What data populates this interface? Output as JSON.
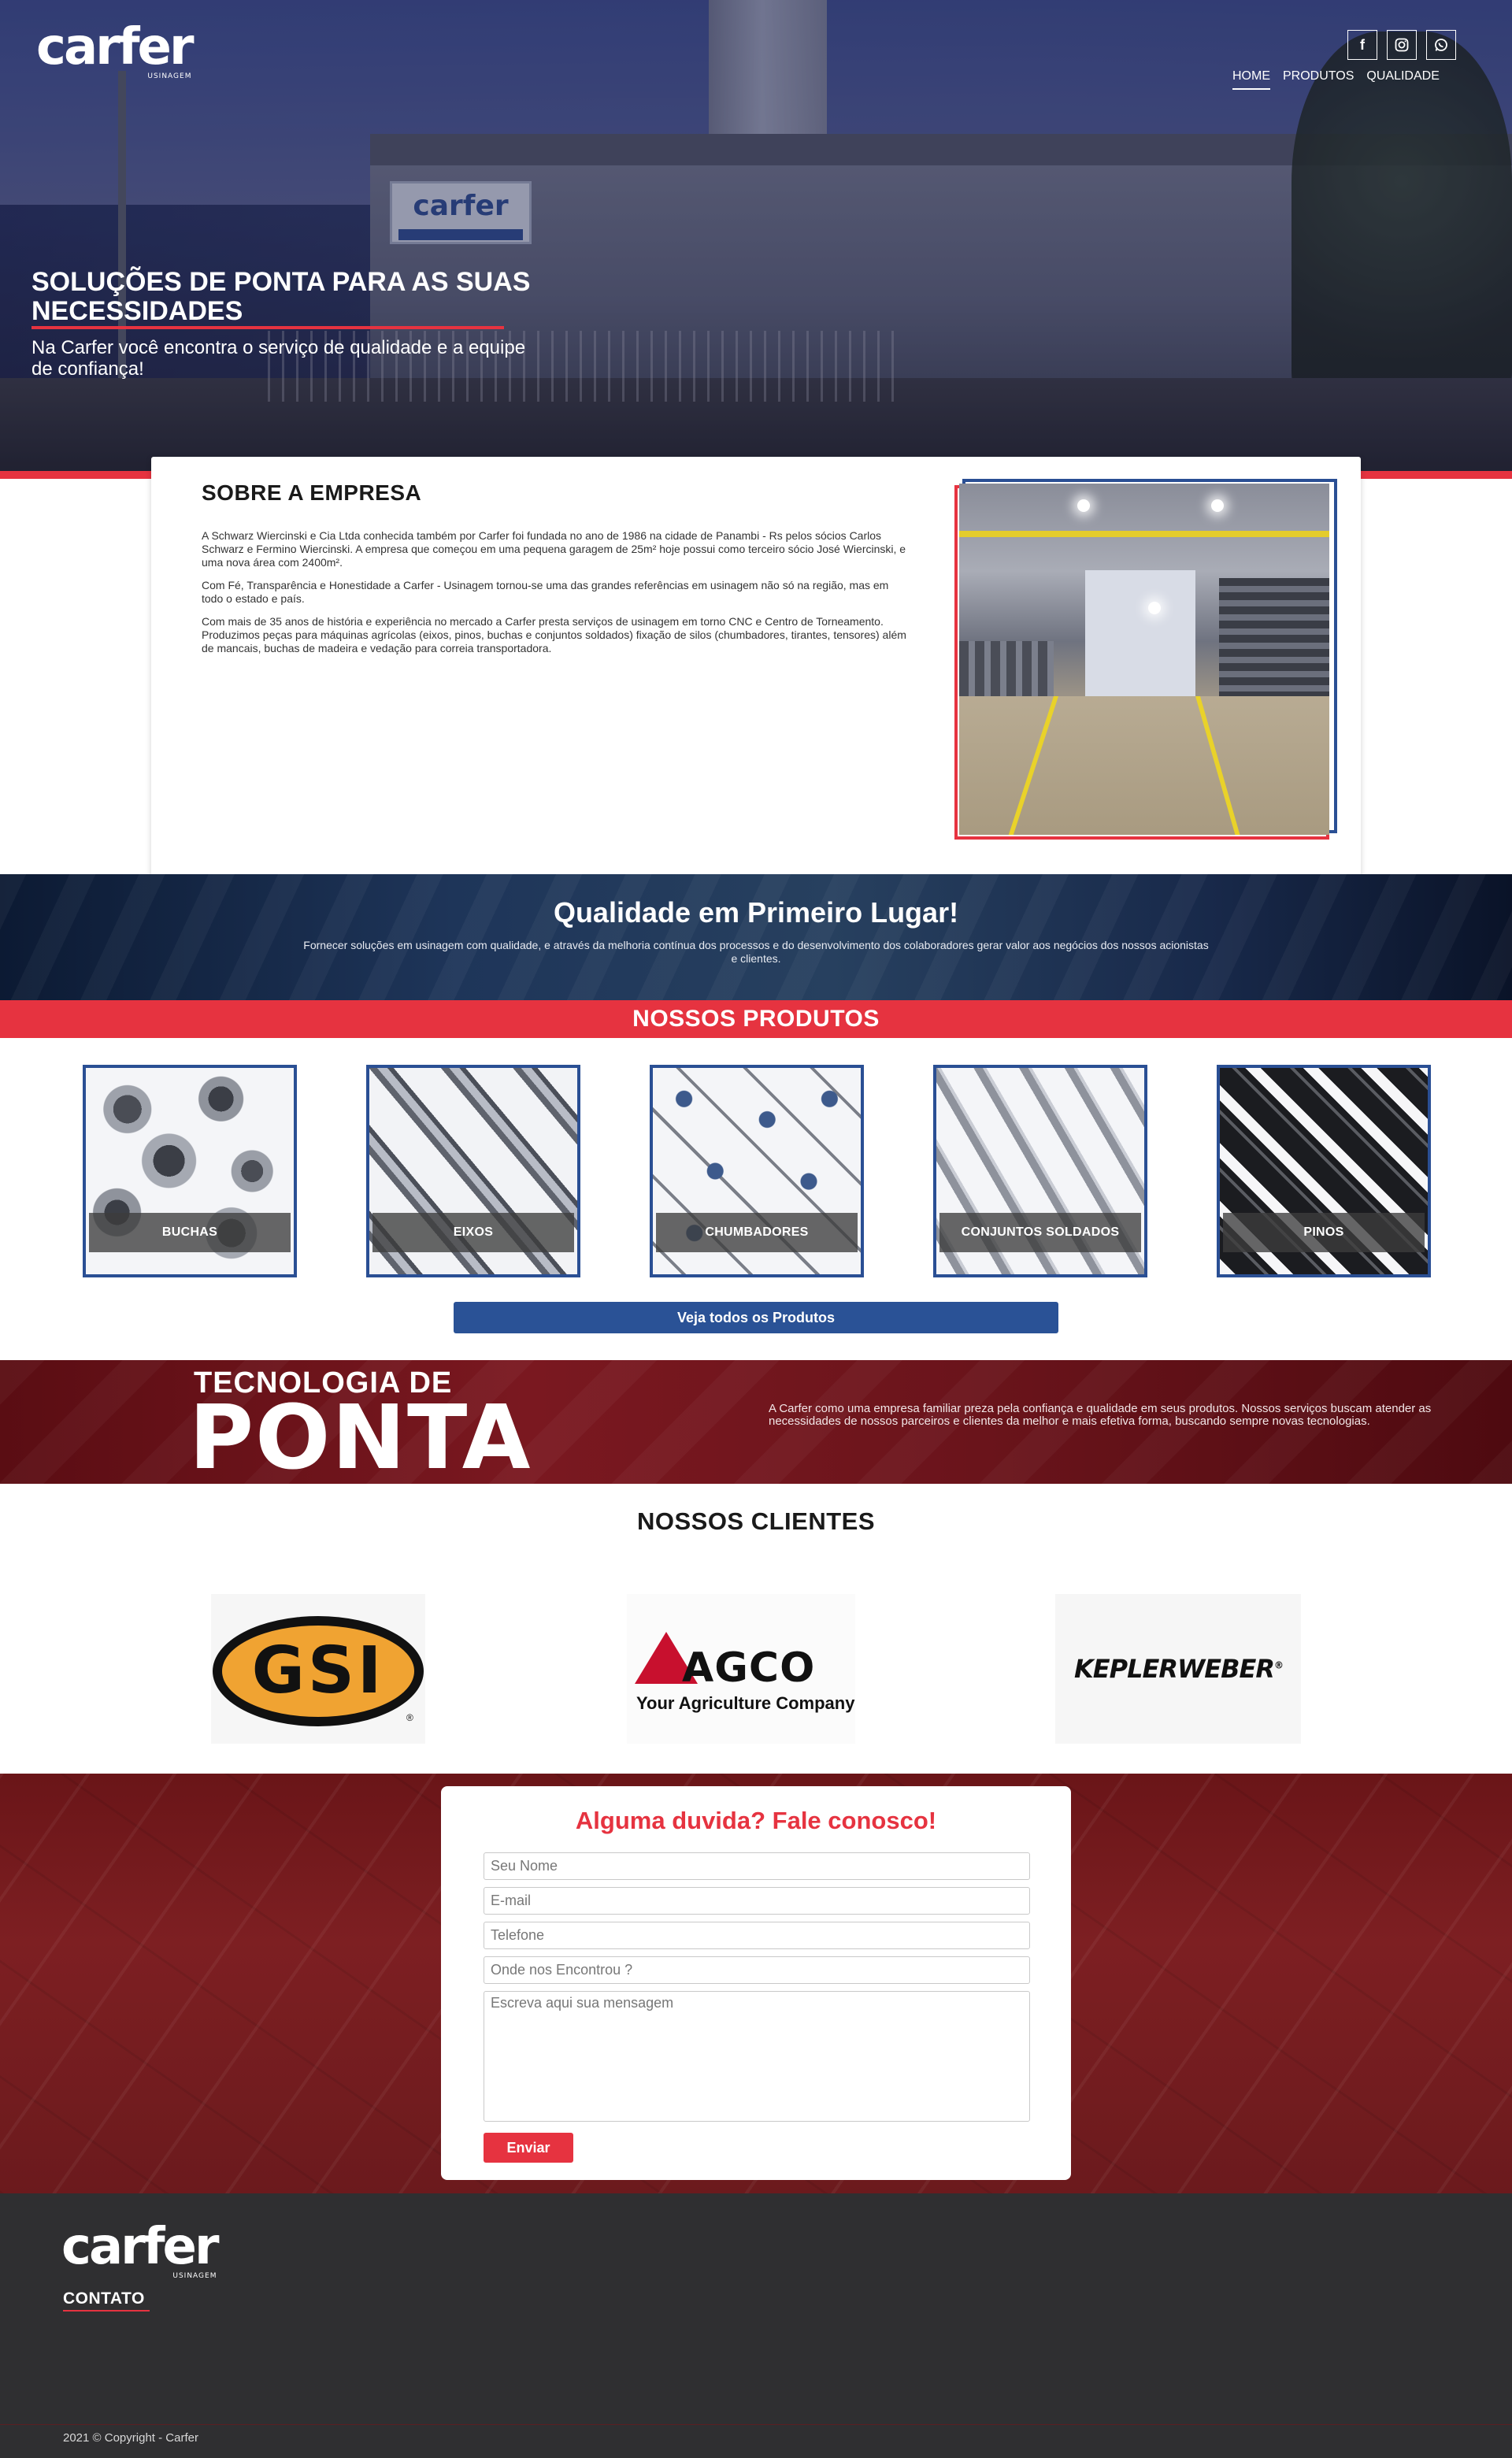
{
  "brand": {
    "logo_word": "carfer",
    "logo_sub": "USINAGEM"
  },
  "social": {
    "facebook_glyph": "f",
    "instagram_glyph": "◎",
    "whatsapp_glyph": "✆"
  },
  "nav": {
    "items": [
      {
        "label": "HOME",
        "active": true
      },
      {
        "label": "PRODUTOS"
      },
      {
        "label": "QUALIDADE"
      }
    ]
  },
  "hero": {
    "title": "SOLUÇÕES DE PONTA PARA AS SUAS NECESSIDADES",
    "subtitle": "Na Carfer você encontra o serviço de qualidade e a equipe de confiança!",
    "sign_text": "carfer"
  },
  "about": {
    "title": "SOBRE A EMPRESA",
    "paragraphs": [
      "A Schwarz Wiercinski e Cia Ltda conhecida também por Carfer foi fundada no ano de 1986 na cidade de Panambi - Rs pelos sócios Carlos Schwarz e Fermino Wiercinski. A empresa que começou em uma pequena garagem de 25m² hoje possui como terceiro sócio José Wiercinski, e uma nova área com 2400m².",
      "Com Fé, Transparência e Honestidade a Carfer - Usinagem tornou-se uma das grandes referências em usinagem não só na região, mas em todo o estado e país.",
      "Com mais de 35 anos de história e experiência no mercado a Carfer presta serviços de usinagem em torno CNC e Centro de Torneamento. Produzimos peças para máquinas agrícolas (eixos, pinos, buchas e conjuntos soldados) fixação de silos (chumbadores, tirantes, tensores) além de mancais, buchas de madeira e vedação para correia transportadora."
    ]
  },
  "quality": {
    "title": "Qualidade em Primeiro Lugar!",
    "text": "Fornecer soluções em usinagem com qualidade, e através da melhoria contínua dos processos e do desenvolvimento dos colaboradores gerar valor aos negócios dos nossos acionistas e clientes."
  },
  "products": {
    "title": "NOSSOS PRODUTOS",
    "items": [
      {
        "label": "BUCHAS"
      },
      {
        "label": "EIXOS"
      },
      {
        "label": "CHUMBADORES"
      },
      {
        "label": "CONJUNTOS SOLDADOS"
      },
      {
        "label": "PINOS"
      }
    ],
    "all_button": "Veja todos os Produtos"
  },
  "tech": {
    "line1": "TECNOLOGIA DE",
    "line2": "PONTA",
    "text": "A Carfer como uma empresa familiar preza pela confiança e qualidade em seus produtos. Nossos serviços buscam atender as necessidades de nossos parceiros e clientes da melhor e mais efetiva forma, buscando sempre novas tecnologias."
  },
  "clients": {
    "title": "NOSSOS CLIENTES",
    "gsi": {
      "name": "GSI",
      "reg": "®"
    },
    "agco": {
      "name": "AGCO",
      "tagline": "Your Agriculture Company"
    },
    "kepler": {
      "name": "KEPLERWEBER",
      "reg": "®"
    }
  },
  "contact": {
    "title": "Alguma duvida? Fale conosco!",
    "name_placeholder": "Seu Nome",
    "email_placeholder": "E-mail",
    "phone_placeholder": "Telefone",
    "source_placeholder": "Onde nos Encontrou ?",
    "message_placeholder": "Escreva aqui sua mensagem",
    "send_label": "Enviar"
  },
  "footer": {
    "contact_label": "CONTATO",
    "copyright": "2021 © Copyright - Carfer"
  },
  "colors": {
    "accent_red": "#e63340",
    "accent_blue": "#2a5296",
    "footer_bg": "#2f2f31"
  }
}
